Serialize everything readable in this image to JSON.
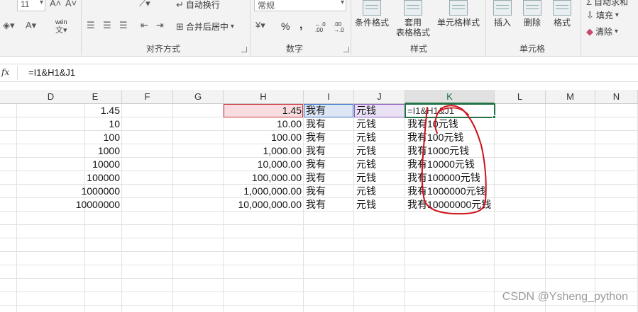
{
  "ribbon": {
    "font_size": "11",
    "wen_label": "wén",
    "alignment": {
      "wrap_text": "自动换行",
      "merge_center": "合并后居中",
      "group_title": "对齐方式"
    },
    "number": {
      "format_value": "常规",
      "percent": "%",
      "comma": ",",
      "inc_decimal": "←.0 .00",
      "dec_decimal": ".00 →.0",
      "group_title": "数字"
    },
    "styles": {
      "conditional": "条件格式",
      "table_format_line1": "套用",
      "table_format_line2": "表格格式",
      "cell_styles": "单元格样式",
      "group_title": "样式"
    },
    "cells": {
      "insert": "插入",
      "delete": "删除",
      "format": "格式",
      "group_title": "单元格"
    },
    "editing": {
      "autosum": "自动求和",
      "fill": "填充",
      "clear": "清除"
    }
  },
  "formula_bar": {
    "fx": "fx",
    "formula": "=I1&H1&J1"
  },
  "columns": [
    "D",
    "E",
    "F",
    "G",
    "H",
    "I",
    "J",
    "K",
    "L",
    "M",
    "N"
  ],
  "active_column": "K",
  "rows": [
    {
      "E": "1.45",
      "H": "1.45",
      "I": "我有",
      "J": "元钱",
      "K": "=I1&H1&J1"
    },
    {
      "E": "10",
      "H": "10.00",
      "I": "我有",
      "J": "元钱",
      "K": "我有10元钱"
    },
    {
      "E": "100",
      "H": "100.00",
      "I": "我有",
      "J": "元钱",
      "K": "我有100元钱"
    },
    {
      "E": "1000",
      "H": "1,000.00",
      "I": "我有",
      "J": "元钱",
      "K": "我有1000元钱"
    },
    {
      "E": "10000",
      "H": "10,000.00",
      "I": "我有",
      "J": "元钱",
      "K": "我有10000元钱"
    },
    {
      "E": "100000",
      "H": "100,000.00",
      "I": "我有",
      "J": "元钱",
      "K": "我有100000元钱"
    },
    {
      "E": "1000000",
      "H": "1,000,000.00",
      "I": "我有",
      "J": "元钱",
      "K": "我有1000000元钱"
    },
    {
      "E": "10000000",
      "H": "10,000,000.00",
      "I": "我有",
      "J": "元钱",
      "K": "我有10000000元钱"
    }
  ],
  "watermark": "CSDN @Ysheng_python",
  "colors": {
    "accent": "#217346",
    "ref_h": "#c8323c",
    "ref_i": "#3b72c4",
    "ref_j": "#8a5cc0",
    "annotation": "#d0101a"
  }
}
